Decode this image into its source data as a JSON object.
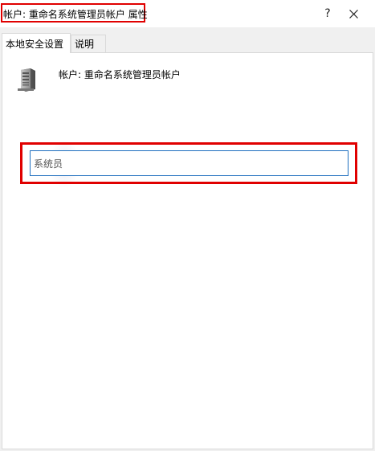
{
  "window": {
    "title": "帐户: 重命名系统管理员帐户 属性",
    "help_label": "?",
    "close_icon": "close-icon"
  },
  "tabs": [
    {
      "label": "本地安全设置",
      "active": true
    },
    {
      "label": "说明",
      "active": false
    }
  ],
  "panel": {
    "icon": "server-icon",
    "heading": "帐户: 重命名系统管理员帐户",
    "account_name_value": "系统员"
  },
  "colors": {
    "highlight_red": "#e00000",
    "input_border": "#1f6fbf",
    "background": "#f0f0f0"
  }
}
